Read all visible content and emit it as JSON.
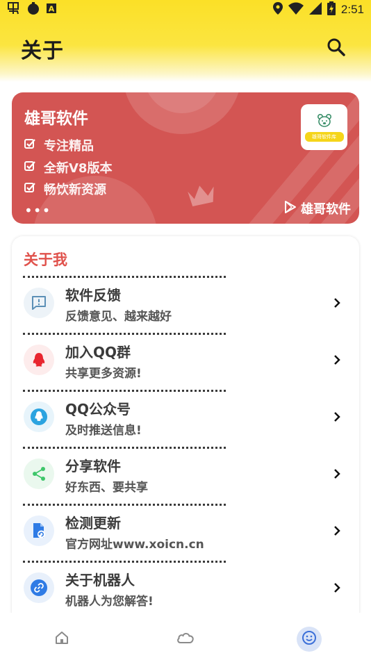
{
  "status_bar": {
    "time": "2:51",
    "left_icons": [
      "notification-app-icon",
      "notification-circle-icon",
      "notification-a-icon"
    ],
    "right_icons": [
      "location-icon",
      "wifi-icon",
      "signal-icon",
      "battery-icon"
    ]
  },
  "header": {
    "title": "关于",
    "search_icon": "search-icon"
  },
  "banner": {
    "title": "雄哥软件",
    "features": [
      "专注精品",
      "全新V8版本",
      "畅饮新资源"
    ],
    "more": "•••",
    "brand_label": "雄哥软件",
    "logo_text": "雄哥软件库",
    "color": "#d35553"
  },
  "about": {
    "section_title": "关于我",
    "accent_color": "#e0524c",
    "items": [
      {
        "title": "软件反馈",
        "subtitle": "反馈意见、越来越好",
        "icon": "feedback-icon"
      },
      {
        "title": "加入QQ群",
        "subtitle": "共享更多资源!",
        "icon": "qq-penguin-icon"
      },
      {
        "title": "QQ公众号",
        "subtitle": "及时推送信息!",
        "icon": "qq-bell-icon"
      },
      {
        "title": "分享软件",
        "subtitle": "好东西、要共享",
        "icon": "share-icon"
      },
      {
        "title": "检测更新",
        "subtitle": "官方网址www.xoicn.cn",
        "icon": "update-icon"
      },
      {
        "title": "关于机器人",
        "subtitle": "机器人为您解答!",
        "icon": "robot-link-icon"
      }
    ]
  },
  "bottom_nav": {
    "items": [
      "home-icon",
      "cloud-icon",
      "smiley-icon"
    ],
    "active": "smiley-icon"
  }
}
